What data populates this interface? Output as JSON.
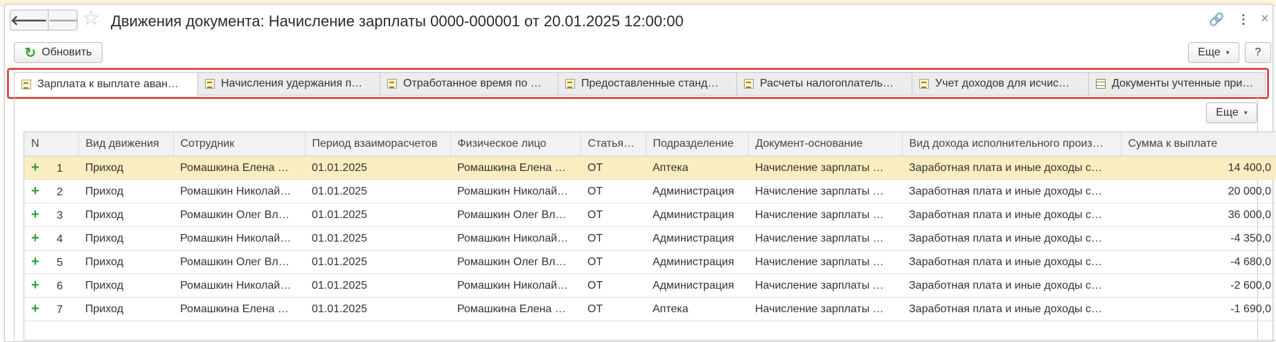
{
  "window": {
    "title": "Движения документа: Начисление зарплаты 0000-000001 от 20.01.2025 12:00:00",
    "icons": [
      "back-arrow-icon",
      "forward-arrow-icon",
      "star-icon",
      "link-icon",
      "more-vertical-icon",
      "close-icon"
    ],
    "glyphs": {
      "back": "🡐",
      "forward": "🡒",
      "star": "☆",
      "link": "🔗",
      "more": "⋮",
      "close": "×"
    }
  },
  "toolbar": {
    "refresh_label": "Обновить",
    "refresh_glyph": "↻",
    "more_label": "Еще",
    "help_label": "?",
    "caret": "▾"
  },
  "tabs": [
    {
      "label": "Зарплата к выплате аван…",
      "icon": "document-icon",
      "active": true
    },
    {
      "label": "Начисления удержания п…",
      "icon": "document-icon"
    },
    {
      "label": "Отработанное время по …",
      "icon": "document-icon"
    },
    {
      "label": "Предоставленные станд…",
      "icon": "document-icon"
    },
    {
      "label": "Расчеты налогоплатель…",
      "icon": "document-icon"
    },
    {
      "label": "Учет доходов для исчис…",
      "icon": "document-icon"
    },
    {
      "label": "Документы учтенные при…",
      "icon": "table-icon"
    }
  ],
  "panel": {
    "more_label": "Еще"
  },
  "table": {
    "columns": [
      "N",
      "Вид движения",
      "Сотрудник",
      "Период взаиморасчетов",
      "Физическое лицо",
      "Статья…",
      "Подразделение",
      "Документ-основание",
      "Вид дохода исполнительного произ…",
      "Сумма к выплате"
    ],
    "rows": [
      {
        "n": "1",
        "vid": "Приход",
        "employee": "Ромашкина Елена …",
        "period": "01.01.2025",
        "person": "Ромашкина Елена …",
        "article": "ОТ",
        "division": "Аптека",
        "doc": "Начисление зарплаты …",
        "income": "Заработная плата и иные доходы с…",
        "sum": "14 400,0",
        "selected": true
      },
      {
        "n": "2",
        "vid": "Приход",
        "employee": "Ромашкин Николай…",
        "period": "01.01.2025",
        "person": "Ромашкин Николай…",
        "article": "ОТ",
        "division": "Администрация",
        "doc": "Начисление зарплаты …",
        "income": "Заработная плата и иные доходы с…",
        "sum": "20 000,0"
      },
      {
        "n": "3",
        "vid": "Приход",
        "employee": "Ромашкин Олег Вл…",
        "period": "01.01.2025",
        "person": "Ромашкин Олег Вл…",
        "article": "ОТ",
        "division": "Администрация",
        "doc": "Начисление зарплаты …",
        "income": "Заработная плата и иные доходы с…",
        "sum": "36 000,0"
      },
      {
        "n": "4",
        "vid": "Приход",
        "employee": "Ромашкин Николай…",
        "period": "01.01.2025",
        "person": "Ромашкин Николай…",
        "article": "ОТ",
        "division": "Администрация",
        "doc": "Начисление зарплаты …",
        "income": "Заработная плата и иные доходы с…",
        "sum": "-4 350,0"
      },
      {
        "n": "5",
        "vid": "Приход",
        "employee": "Ромашкин Олег Вл…",
        "period": "01.01.2025",
        "person": "Ромашкин Олег Вл…",
        "article": "ОТ",
        "division": "Администрация",
        "doc": "Начисление зарплаты …",
        "income": "Заработная плата и иные доходы с…",
        "sum": "-4 680,0"
      },
      {
        "n": "6",
        "vid": "Приход",
        "employee": "Ромашкин Николай…",
        "period": "01.01.2025",
        "person": "Ромашкин Николай…",
        "article": "ОТ",
        "division": "Администрация",
        "doc": "Начисление зарплаты …",
        "income": "Заработная плата и иные доходы с…",
        "sum": "-2 600,0"
      },
      {
        "n": "7",
        "vid": "Приход",
        "employee": "Ромашкина Елена …",
        "period": "01.01.2025",
        "person": "Ромашкина Елена …",
        "article": "ОТ",
        "division": "Аптека",
        "doc": "Начисление зарплаты …",
        "income": "Заработная плата и иные доходы с…",
        "sum": "-1 690,0"
      }
    ],
    "row_marker": "+"
  },
  "colors": {
    "accent_highlight": "#d9534f",
    "selected_row": "#fbedc2",
    "plus_green": "#2e9e3c",
    "top_strip": "#fbf3dc"
  }
}
